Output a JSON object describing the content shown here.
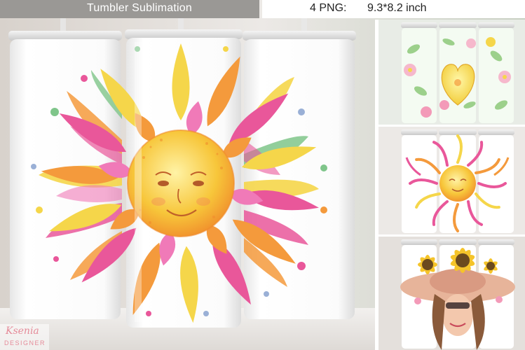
{
  "header": {
    "title": "Tumbler Sublimation",
    "png_count": "4 PNG:",
    "dimensions": "9.3*8.2 inch"
  },
  "logo": {
    "line1": "Ksenia",
    "line2": "DESIGNER"
  },
  "colors": {
    "header_bar": "#9a9895",
    "sun_core": "#f7c63a",
    "petal_pink": "#e9579a",
    "petal_orange": "#f49a3c",
    "petal_yellow": "#f5d64a",
    "leaf_green": "#7fc58a",
    "accent_logo": "#e58c9a"
  },
  "icons": [
    "smiling-sun-mandala",
    "heart-flower-bouquet",
    "sunflower-hat-woman"
  ]
}
